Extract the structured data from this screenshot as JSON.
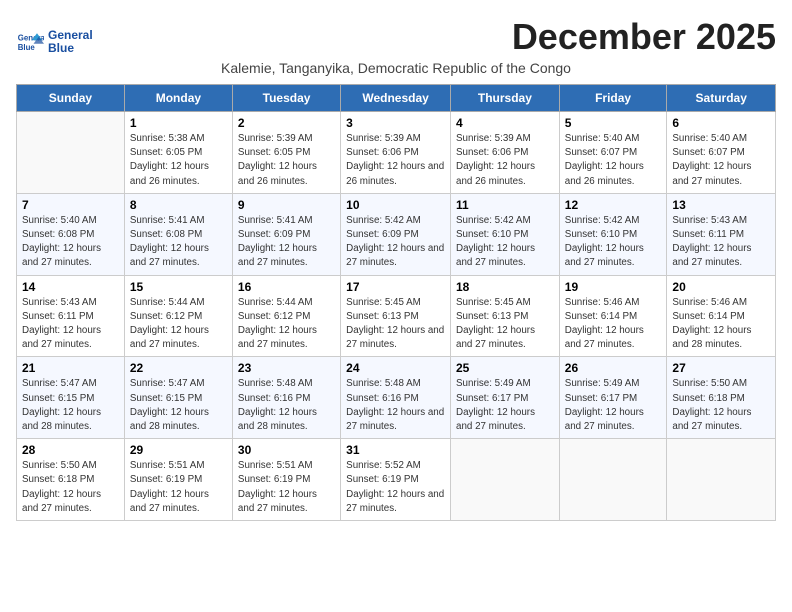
{
  "logo": {
    "line1": "General",
    "line2": "Blue"
  },
  "title": "December 2025",
  "subtitle": "Kalemie, Tanganyika, Democratic Republic of the Congo",
  "days_of_week": [
    "Sunday",
    "Monday",
    "Tuesday",
    "Wednesday",
    "Thursday",
    "Friday",
    "Saturday"
  ],
  "weeks": [
    [
      {
        "day": "",
        "sunrise": "",
        "sunset": "",
        "daylight": ""
      },
      {
        "day": "1",
        "sunrise": "Sunrise: 5:38 AM",
        "sunset": "Sunset: 6:05 PM",
        "daylight": "Daylight: 12 hours and 26 minutes."
      },
      {
        "day": "2",
        "sunrise": "Sunrise: 5:39 AM",
        "sunset": "Sunset: 6:05 PM",
        "daylight": "Daylight: 12 hours and 26 minutes."
      },
      {
        "day": "3",
        "sunrise": "Sunrise: 5:39 AM",
        "sunset": "Sunset: 6:06 PM",
        "daylight": "Daylight: 12 hours and 26 minutes."
      },
      {
        "day": "4",
        "sunrise": "Sunrise: 5:39 AM",
        "sunset": "Sunset: 6:06 PM",
        "daylight": "Daylight: 12 hours and 26 minutes."
      },
      {
        "day": "5",
        "sunrise": "Sunrise: 5:40 AM",
        "sunset": "Sunset: 6:07 PM",
        "daylight": "Daylight: 12 hours and 26 minutes."
      },
      {
        "day": "6",
        "sunrise": "Sunrise: 5:40 AM",
        "sunset": "Sunset: 6:07 PM",
        "daylight": "Daylight: 12 hours and 27 minutes."
      }
    ],
    [
      {
        "day": "7",
        "sunrise": "Sunrise: 5:40 AM",
        "sunset": "Sunset: 6:08 PM",
        "daylight": "Daylight: 12 hours and 27 minutes."
      },
      {
        "day": "8",
        "sunrise": "Sunrise: 5:41 AM",
        "sunset": "Sunset: 6:08 PM",
        "daylight": "Daylight: 12 hours and 27 minutes."
      },
      {
        "day": "9",
        "sunrise": "Sunrise: 5:41 AM",
        "sunset": "Sunset: 6:09 PM",
        "daylight": "Daylight: 12 hours and 27 minutes."
      },
      {
        "day": "10",
        "sunrise": "Sunrise: 5:42 AM",
        "sunset": "Sunset: 6:09 PM",
        "daylight": "Daylight: 12 hours and 27 minutes."
      },
      {
        "day": "11",
        "sunrise": "Sunrise: 5:42 AM",
        "sunset": "Sunset: 6:10 PM",
        "daylight": "Daylight: 12 hours and 27 minutes."
      },
      {
        "day": "12",
        "sunrise": "Sunrise: 5:42 AM",
        "sunset": "Sunset: 6:10 PM",
        "daylight": "Daylight: 12 hours and 27 minutes."
      },
      {
        "day": "13",
        "sunrise": "Sunrise: 5:43 AM",
        "sunset": "Sunset: 6:11 PM",
        "daylight": "Daylight: 12 hours and 27 minutes."
      }
    ],
    [
      {
        "day": "14",
        "sunrise": "Sunrise: 5:43 AM",
        "sunset": "Sunset: 6:11 PM",
        "daylight": "Daylight: 12 hours and 27 minutes."
      },
      {
        "day": "15",
        "sunrise": "Sunrise: 5:44 AM",
        "sunset": "Sunset: 6:12 PM",
        "daylight": "Daylight: 12 hours and 27 minutes."
      },
      {
        "day": "16",
        "sunrise": "Sunrise: 5:44 AM",
        "sunset": "Sunset: 6:12 PM",
        "daylight": "Daylight: 12 hours and 27 minutes."
      },
      {
        "day": "17",
        "sunrise": "Sunrise: 5:45 AM",
        "sunset": "Sunset: 6:13 PM",
        "daylight": "Daylight: 12 hours and 27 minutes."
      },
      {
        "day": "18",
        "sunrise": "Sunrise: 5:45 AM",
        "sunset": "Sunset: 6:13 PM",
        "daylight": "Daylight: 12 hours and 27 minutes."
      },
      {
        "day": "19",
        "sunrise": "Sunrise: 5:46 AM",
        "sunset": "Sunset: 6:14 PM",
        "daylight": "Daylight: 12 hours and 27 minutes."
      },
      {
        "day": "20",
        "sunrise": "Sunrise: 5:46 AM",
        "sunset": "Sunset: 6:14 PM",
        "daylight": "Daylight: 12 hours and 28 minutes."
      }
    ],
    [
      {
        "day": "21",
        "sunrise": "Sunrise: 5:47 AM",
        "sunset": "Sunset: 6:15 PM",
        "daylight": "Daylight: 12 hours and 28 minutes."
      },
      {
        "day": "22",
        "sunrise": "Sunrise: 5:47 AM",
        "sunset": "Sunset: 6:15 PM",
        "daylight": "Daylight: 12 hours and 28 minutes."
      },
      {
        "day": "23",
        "sunrise": "Sunrise: 5:48 AM",
        "sunset": "Sunset: 6:16 PM",
        "daylight": "Daylight: 12 hours and 28 minutes."
      },
      {
        "day": "24",
        "sunrise": "Sunrise: 5:48 AM",
        "sunset": "Sunset: 6:16 PM",
        "daylight": "Daylight: 12 hours and 27 minutes."
      },
      {
        "day": "25",
        "sunrise": "Sunrise: 5:49 AM",
        "sunset": "Sunset: 6:17 PM",
        "daylight": "Daylight: 12 hours and 27 minutes."
      },
      {
        "day": "26",
        "sunrise": "Sunrise: 5:49 AM",
        "sunset": "Sunset: 6:17 PM",
        "daylight": "Daylight: 12 hours and 27 minutes."
      },
      {
        "day": "27",
        "sunrise": "Sunrise: 5:50 AM",
        "sunset": "Sunset: 6:18 PM",
        "daylight": "Daylight: 12 hours and 27 minutes."
      }
    ],
    [
      {
        "day": "28",
        "sunrise": "Sunrise: 5:50 AM",
        "sunset": "Sunset: 6:18 PM",
        "daylight": "Daylight: 12 hours and 27 minutes."
      },
      {
        "day": "29",
        "sunrise": "Sunrise: 5:51 AM",
        "sunset": "Sunset: 6:19 PM",
        "daylight": "Daylight: 12 hours and 27 minutes."
      },
      {
        "day": "30",
        "sunrise": "Sunrise: 5:51 AM",
        "sunset": "Sunset: 6:19 PM",
        "daylight": "Daylight: 12 hours and 27 minutes."
      },
      {
        "day": "31",
        "sunrise": "Sunrise: 5:52 AM",
        "sunset": "Sunset: 6:19 PM",
        "daylight": "Daylight: 12 hours and 27 minutes."
      },
      {
        "day": "",
        "sunrise": "",
        "sunset": "",
        "daylight": ""
      },
      {
        "day": "",
        "sunrise": "",
        "sunset": "",
        "daylight": ""
      },
      {
        "day": "",
        "sunrise": "",
        "sunset": "",
        "daylight": ""
      }
    ]
  ]
}
